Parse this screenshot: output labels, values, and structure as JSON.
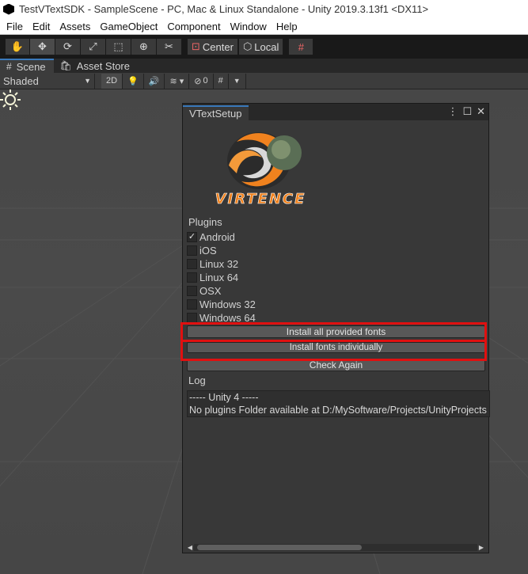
{
  "window": {
    "title": "TestVTextSDK - SampleScene - PC, Mac & Linux Standalone - Unity 2019.3.13f1 <DX11>"
  },
  "menu": [
    "File",
    "Edit",
    "Assets",
    "GameObject",
    "Component",
    "Window",
    "Help"
  ],
  "toolbar": {
    "tools": [
      "hand-tool",
      "move-tool",
      "rotate-tool",
      "scale-tool",
      "rect-tool",
      "transform-tool",
      "custom-tool"
    ],
    "pivot_label": "Center",
    "space_label": "Local"
  },
  "tabs": {
    "scene": "Scene",
    "asset_store": "Asset Store"
  },
  "scene_toolbar": {
    "draw_mode": "Shaded",
    "mode_2d": "2D",
    "hidden_count": "0"
  },
  "vtext": {
    "tab_title": "VTextSetup",
    "logo_text": "VIRTENCE",
    "plugins_label": "Plugins",
    "plugins": [
      {
        "label": "Android",
        "checked": true
      },
      {
        "label": "iOS",
        "checked": false
      },
      {
        "label": "Linux 32",
        "checked": false
      },
      {
        "label": "Linux 64",
        "checked": false
      },
      {
        "label": "OSX",
        "checked": false
      },
      {
        "label": "Windows 32",
        "checked": false
      },
      {
        "label": "Windows 64",
        "checked": false
      }
    ],
    "buttons": {
      "install_all": "Install all provided fonts",
      "install_individually": "Install fonts individually",
      "check_again": "Check Again"
    },
    "log_label": "Log",
    "log_lines": [
      "----- Unity 4 -----",
      "No plugins Folder available at D:/MySoftware/Projects/UnityProjects"
    ]
  },
  "colors": {
    "accent": "#3a79bb",
    "highlight": "#e01010",
    "logo_orange": "#f0821e"
  }
}
